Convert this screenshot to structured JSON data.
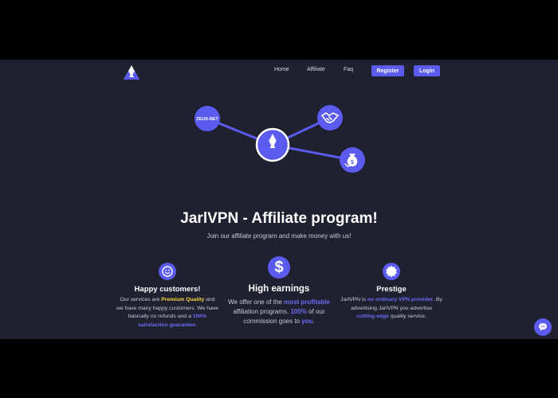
{
  "nav": {
    "links": [
      "Home",
      "Affiliate",
      "Faq"
    ],
    "register_label": "Register",
    "login_label": "Login"
  },
  "network": {
    "partner_label": "ZEUS-NET"
  },
  "hero": {
    "title": "JarlVPN - Affiliate program!",
    "subtitle": "Join our affiliate program and make money with us!"
  },
  "features": [
    {
      "icon": "smile-icon",
      "title": "Happy customers!",
      "text_parts": [
        "Our services are ",
        "Premium Quality",
        " and we have many happy customers. We have basically no refunds and a ",
        "100% satisfaction guarantee",
        "."
      ]
    },
    {
      "icon": "dollar-icon",
      "title": "High earnings",
      "text_parts": [
        "We offer one of the ",
        "most profitable",
        " affiliation programs. ",
        "100%",
        " of our commission goes to ",
        "you",
        "."
      ]
    },
    {
      "icon": "badge-icon",
      "title": "Prestige",
      "text_parts": [
        "JarlVPN is ",
        "no ordinary VPN provider",
        ". By advertising JarlVPN you advertise ",
        "cutting-edge",
        " quality service."
      ]
    }
  ],
  "colors": {
    "accent": "#5b5bf0",
    "background": "#1f2030",
    "highlight_yellow": "#f5d742",
    "highlight_blue": "#6b6bf5"
  }
}
